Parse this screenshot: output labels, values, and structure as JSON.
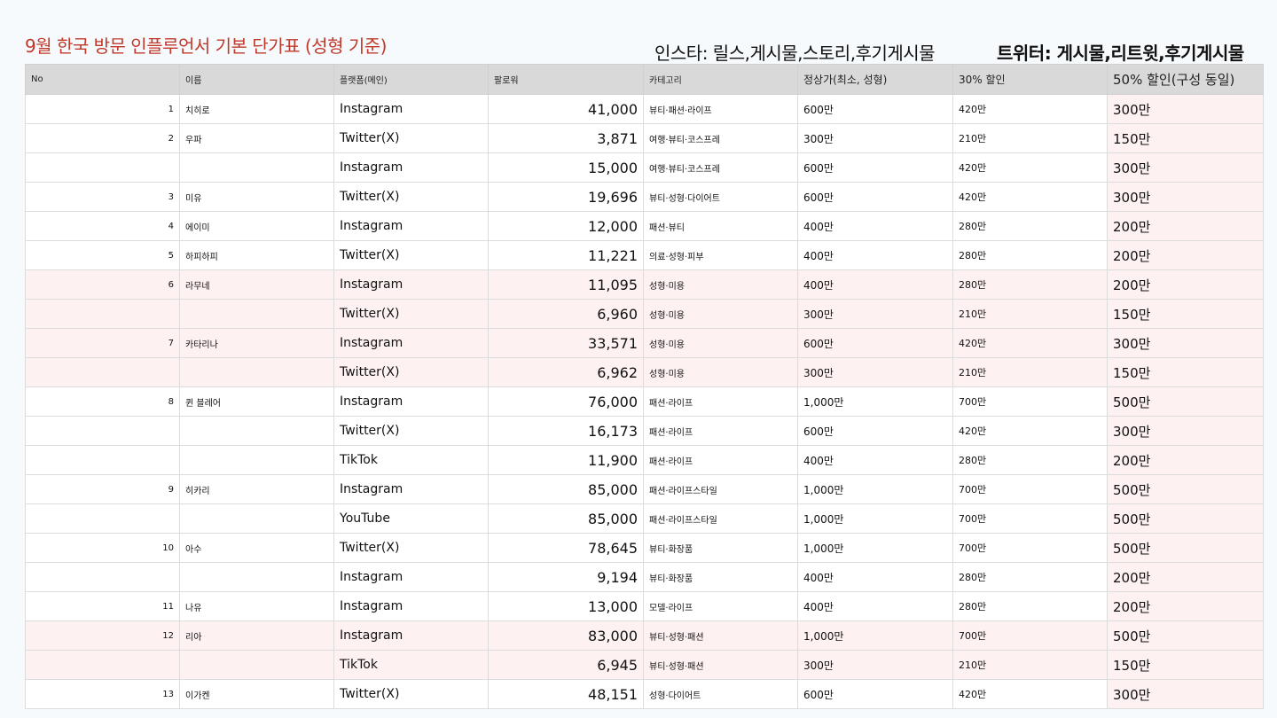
{
  "title": "9월 한국 방문 인플루언서 기본 단가표 (성형 기준)",
  "notes": {
    "instagram": "인스타: 릴스,게시물,스토리,후기게시물",
    "twitter": "트위터: 게시물,리트윗,후기게시물"
  },
  "headers": [
    "No",
    "이름",
    "플랫폼(메인)",
    "팔로워",
    "카테고리",
    "정상가(최소, 성형)",
    "30% 할인",
    "50% 할인(구성 동일)"
  ],
  "rows": [
    {
      "no": "1",
      "name": "치히로",
      "platform": "Instagram",
      "followers": "41,000",
      "category": "뷰티·패션·라이프",
      "price": "600만",
      "d30": "420만",
      "d50": "300만",
      "pink": false
    },
    {
      "no": "2",
      "name": "우파",
      "platform": "Twitter(X)",
      "followers": "3,871",
      "category": "여행·뷰티·코스프레",
      "price": "300만",
      "d30": "210만",
      "d50": "150만",
      "pink": false
    },
    {
      "no": "",
      "name": "",
      "platform": "Instagram",
      "followers": "15,000",
      "category": "여행·뷰티·코스프레",
      "price": "600만",
      "d30": "420만",
      "d50": "300만",
      "pink": false
    },
    {
      "no": "3",
      "name": "미유",
      "platform": "Twitter(X)",
      "followers": "19,696",
      "category": "뷰티·성형·다이어트",
      "price": "600만",
      "d30": "420만",
      "d50": "300만",
      "pink": false
    },
    {
      "no": "4",
      "name": "에이미",
      "platform": "Instagram",
      "followers": "12,000",
      "category": "패션·뷰티",
      "price": "400만",
      "d30": "280만",
      "d50": "200만",
      "pink": false
    },
    {
      "no": "5",
      "name": "하피하피",
      "platform": "Twitter(X)",
      "followers": "11,221",
      "category": "의료·성형·피부",
      "price": "400만",
      "d30": "280만",
      "d50": "200만",
      "pink": false
    },
    {
      "no": "6",
      "name": "라무네",
      "platform": "Instagram",
      "followers": "11,095",
      "category": "성형·미용",
      "price": "400만",
      "d30": "280만",
      "d50": "200만",
      "pink": true
    },
    {
      "no": "",
      "name": "",
      "platform": "Twitter(X)",
      "followers": "6,960",
      "category": "성형·미용",
      "price": "300만",
      "d30": "210만",
      "d50": "150만",
      "pink": true
    },
    {
      "no": "7",
      "name": "카타리나",
      "platform": "Instagram",
      "followers": "33,571",
      "category": "성형·미용",
      "price": "600만",
      "d30": "420만",
      "d50": "300만",
      "pink": true
    },
    {
      "no": "",
      "name": "",
      "platform": "Twitter(X)",
      "followers": "6,962",
      "category": "성형·미용",
      "price": "300만",
      "d30": "210만",
      "d50": "150만",
      "pink": true
    },
    {
      "no": "8",
      "name": "퀸 블레어",
      "platform": "Instagram",
      "followers": "76,000",
      "category": "패션·라이프",
      "price": "1,000만",
      "d30": "700만",
      "d50": "500만",
      "pink": false
    },
    {
      "no": "",
      "name": "",
      "platform": "Twitter(X)",
      "followers": "16,173",
      "category": "패션·라이프",
      "price": "600만",
      "d30": "420만",
      "d50": "300만",
      "pink": false
    },
    {
      "no": "",
      "name": "",
      "platform": "TikTok",
      "followers": "11,900",
      "category": "패션·라이프",
      "price": "400만",
      "d30": "280만",
      "d50": "200만",
      "pink": false
    },
    {
      "no": "9",
      "name": "히카리",
      "platform": "Instagram",
      "followers": "85,000",
      "category": "패션·라이프스타일",
      "price": "1,000만",
      "d30": "700만",
      "d50": "500만",
      "pink": false
    },
    {
      "no": "",
      "name": "",
      "platform": "YouTube",
      "followers": "85,000",
      "category": "패션·라이프스타일",
      "price": "1,000만",
      "d30": "700만",
      "d50": "500만",
      "pink": false
    },
    {
      "no": "10",
      "name": "아수",
      "platform": "Twitter(X)",
      "followers": "78,645",
      "category": "뷰티·화장품",
      "price": "1,000만",
      "d30": "700만",
      "d50": "500만",
      "pink": false
    },
    {
      "no": "",
      "name": "",
      "platform": "Instagram",
      "followers": "9,194",
      "category": "뷰티·화장품",
      "price": "400만",
      "d30": "280만",
      "d50": "200만",
      "pink": false
    },
    {
      "no": "11",
      "name": "나유",
      "platform": "Instagram",
      "followers": "13,000",
      "category": "모델·라이프",
      "price": "400만",
      "d30": "280만",
      "d50": "200만",
      "pink": false
    },
    {
      "no": "12",
      "name": "리아",
      "platform": "Instagram",
      "followers": "83,000",
      "category": "뷰티·성형·패션",
      "price": "1,000만",
      "d30": "700만",
      "d50": "500만",
      "pink": true
    },
    {
      "no": "",
      "name": "",
      "platform": "TikTok",
      "followers": "6,945",
      "category": "뷰티·성형·패션",
      "price": "300만",
      "d30": "210만",
      "d50": "150만",
      "pink": true
    },
    {
      "no": "13",
      "name": "이가켄",
      "platform": "Twitter(X)",
      "followers": "48,151",
      "category": "성형·다이어트",
      "price": "600만",
      "d30": "420만",
      "d50": "300만",
      "pink": false
    }
  ]
}
